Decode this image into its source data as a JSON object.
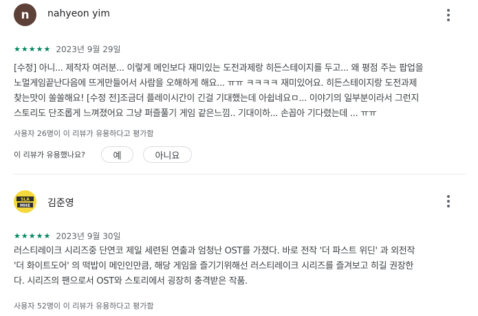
{
  "reviews": [
    {
      "author": "nahyeon yim",
      "avatar_letter": "n",
      "avatar_color": "#5d4037",
      "rating": 5,
      "stars": [
        "★",
        "★",
        "★",
        "★",
        "★"
      ],
      "date": "2023년 9월 29일",
      "lines": [
        "[수정] 아니... 제작자 여러분... 이렇게 메인보다 재미있는 도전과제랑 히든스테이지를 두고... 왜 평점 주는 팝업을",
        "노멀게임끝난다음에 뜨게만들어서 사람을 오해하게 해요... ㅠㅠ ㅋㅋㅋㅋ 재미있어요. 히든스테이지랑 도전과제",
        "찾는맛이 쏠쏠해요! [수정 전]조금더 플레이시간이 긴걸 기대했는데 아쉽네요ㅁ... 이야기의 일부분이라서 그런지",
        "스토리도 단조롭게 느껴졌어요 그냥 퍼즐풀기 게임 같은느낌.. 기대이하... 손꼽아 기다렸는데 ... ㅠㅠ"
      ],
      "helpful_text": "사용자 26명이 이 리뷰가 유용하다고 평가함",
      "question": "이 리뷰가 유용했나요?",
      "yes_label": "예",
      "no_label": "아니요"
    },
    {
      "author": "김준영",
      "avatar_text": "SLA MHE",
      "rating": 5,
      "stars": [
        "★",
        "★",
        "★",
        "★",
        "★"
      ],
      "date": "2023년 9월 30일",
      "lines": [
        "러스티레이크 시리즈중 단연코 제일 세련된 연출과 엄청난 OST를 가졌다. 바로 전작 '더 파스트 위딘' 과 외전작",
        "'더 화이트도어' 의 떡밥이 메인인만큼, 해당 게임을 즐기기위해선 러스티레이크 시리즈를 즐겨보고 히길 권장한",
        "다. 시리즈의 팬으로서 OST와 스토리에서 굉장히 충격받은 작품."
      ],
      "helpful_text": "사용자 52명이 이 리뷰가 유용하다고 평가함"
    }
  ],
  "icons": {
    "more": "more-vert-icon",
    "star": "star-icon"
  },
  "colors": {
    "star": "#01875f",
    "avatar_bg": "#5d4037"
  }
}
